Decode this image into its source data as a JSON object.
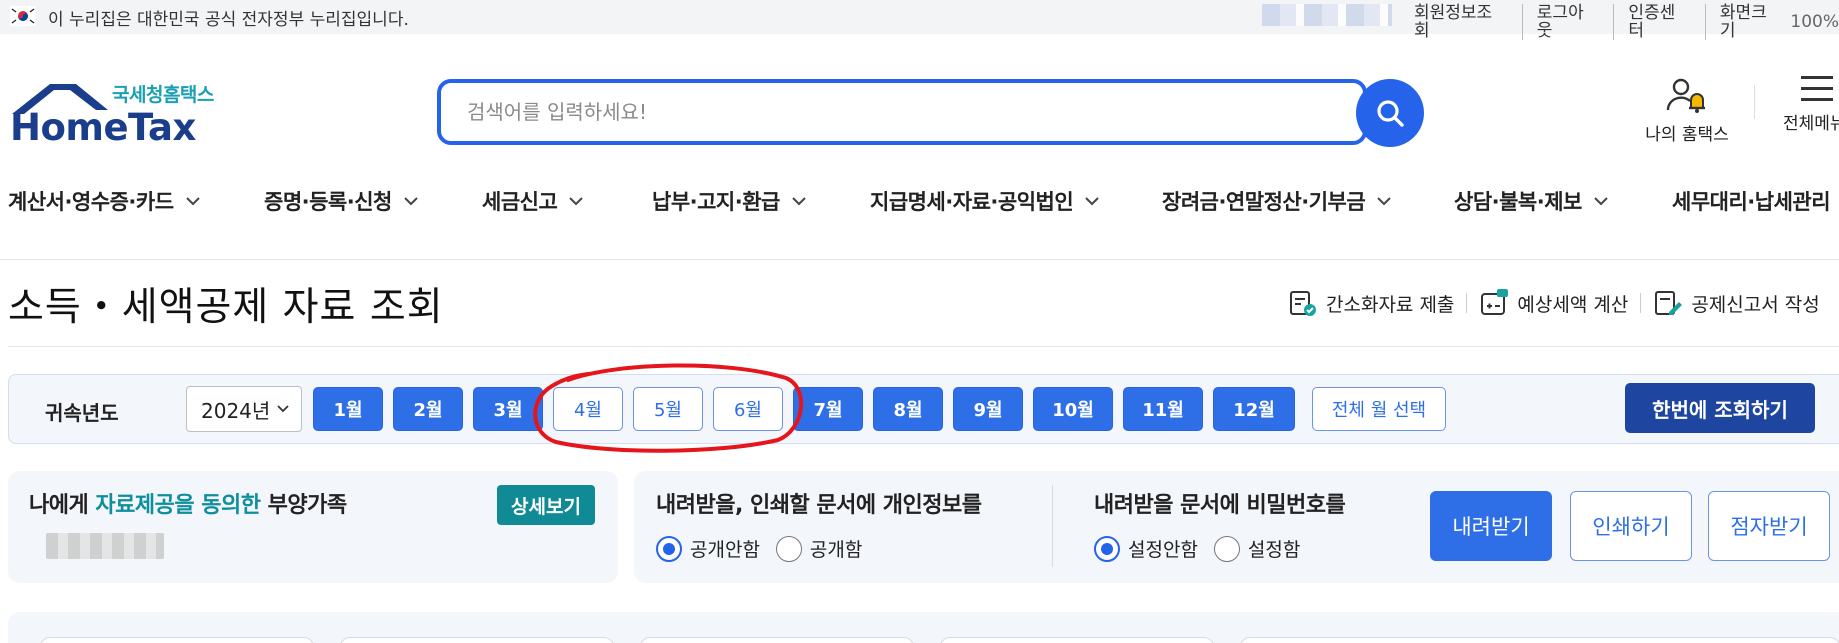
{
  "gov_bar": {
    "notice": "이 누리집은 대한민국 공식 전자정부 누리집입니다.",
    "links": [
      "회원정보조회",
      "로그아웃",
      "인증센터",
      "화면크기"
    ],
    "zoom": "100%"
  },
  "header": {
    "logo_sub": "국세청홈택스",
    "logo_main": "HomeTax",
    "search_placeholder": "검색어를 입력하세요!",
    "my_hometax": "나의 홈택스",
    "all_menu": "전체메뉴"
  },
  "gnb": [
    "계산서·영수증·카드",
    "증명·등록·신청",
    "세금신고",
    "납부·고지·환급",
    "지급명세·자료·공익법인",
    "장려금·연말정산·기부금",
    "상담·불복·제보",
    "세무대리·납세관리"
  ],
  "page": {
    "title": "소득・세액공제 자료 조회",
    "tools": [
      "간소화자료 제출",
      "예상세액 계산",
      "공제신고서 작성"
    ]
  },
  "period": {
    "year_label": "귀속년도",
    "year_value": "2024년",
    "months": [
      {
        "label": "1월",
        "selected": true
      },
      {
        "label": "2월",
        "selected": true
      },
      {
        "label": "3월",
        "selected": true
      },
      {
        "label": "4월",
        "selected": false
      },
      {
        "label": "5월",
        "selected": false
      },
      {
        "label": "6월",
        "selected": false
      },
      {
        "label": "7월",
        "selected": true
      },
      {
        "label": "8월",
        "selected": true
      },
      {
        "label": "9월",
        "selected": true
      },
      {
        "label": "10월",
        "selected": true
      },
      {
        "label": "11월",
        "selected": true
      },
      {
        "label": "12월",
        "selected": true
      }
    ],
    "all_month": "전체 월 선택",
    "query_all": "한번에 조회하기"
  },
  "family": {
    "title_pre": "나에게 ",
    "title_hl": "자료제공을 동의한",
    "title_post": " 부양가족",
    "detail": "상세보기"
  },
  "privacy": {
    "personal_title": "내려받을, 인쇄할 문서에 개인정보를",
    "personal_options": [
      "공개안함",
      "공개함"
    ],
    "password_title": "내려받을 문서에 비밀번호를",
    "password_options": [
      "설정안함",
      "설정함"
    ]
  },
  "actions": {
    "download": "내려받기",
    "print": "인쇄하기",
    "braille": "점자받기"
  },
  "colors": {
    "primary": "#2e6fe8",
    "navy": "#1e46a0",
    "teal": "#108b96",
    "annotation": "#e5161b"
  }
}
